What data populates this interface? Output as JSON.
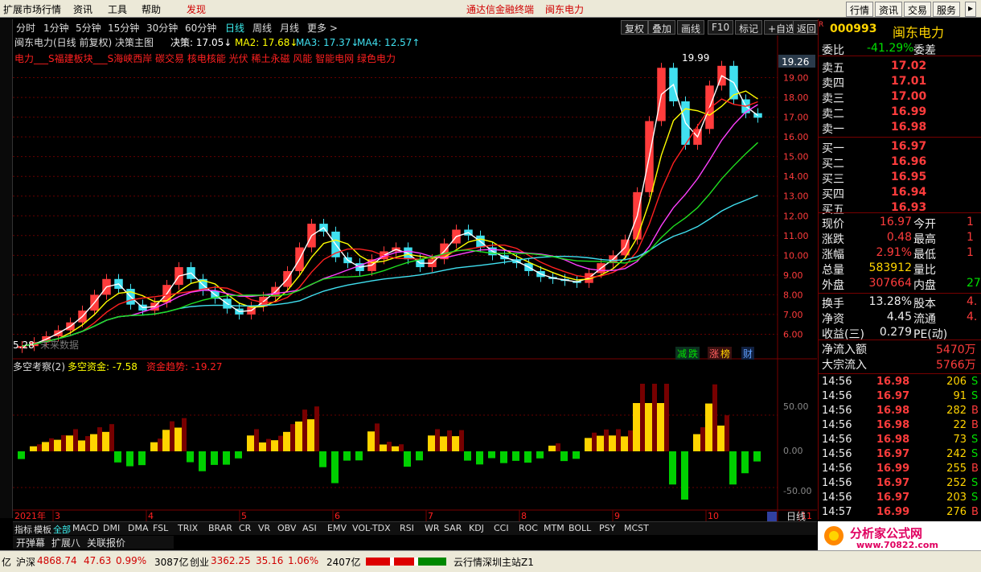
{
  "menu": {
    "items": [
      "扩展市场行情",
      "资讯",
      "工具",
      "帮助"
    ],
    "discover": "发现",
    "promo": "通达信金融终端",
    "promo_stock": "闽东电力",
    "sys_buttons": [
      "行情",
      "资讯",
      "交易",
      "服务"
    ]
  },
  "periods": [
    "分时",
    "1分钟",
    "5分钟",
    "15分钟",
    "30分钟",
    "60分钟",
    "日线",
    "周线",
    "月线",
    "更多 >"
  ],
  "active_period": "日线",
  "toolbar": [
    "复权",
    "叠加",
    "画线",
    "F10",
    "标记",
    "+自选",
    "返回"
  ],
  "chart_header": {
    "title": "闽东电力(日线 前复权) 决策主图",
    "decision": "决策: 17.05↓",
    "ma2": "MA2: 17.68↓",
    "ma3": "MA3: 17.37↓",
    "ma4": "MA4: 12.57↑",
    "concepts": "电力___S福建板块___S海峡西岸 碳交易 核电核能 光伏 稀土永磁 风能 智能电网 绿色电力",
    "high_label": "19.99",
    "low_label": "5.28",
    "future": "未来数据",
    "price_tag": "19.26",
    "badges": [
      "减",
      "跌",
      "涨",
      "榜",
      "财"
    ]
  },
  "price_axis": [
    "19.00",
    "18.00",
    "17.00",
    "16.00",
    "15.00",
    "14.00",
    "13.00",
    "12.00",
    "11.00",
    "10.00",
    "9.00",
    "8.00",
    "7.00",
    "6.00"
  ],
  "indicator": {
    "name": "多空考察(2)",
    "l1": "多空资金: -7.58",
    "l2": "资金趋势: -19.27",
    "axis": [
      "50.00",
      "0.00",
      "-50.00"
    ]
  },
  "time_axis": {
    "year": "2021年",
    "months": [
      "3",
      "4",
      "5",
      "6",
      "7",
      "8",
      "9",
      "10",
      "11"
    ],
    "period": "日线"
  },
  "indicator_tabs": [
    "指标",
    "模板",
    "全部",
    "MACD",
    "DMI",
    "DMA",
    "FSL",
    "TRIX",
    "BRAR",
    "CR",
    "VR",
    "OBV",
    "ASI",
    "EMV",
    "VOL-TDX",
    "RSI",
    "WR",
    "SAR",
    "KDJ",
    "CCI",
    "ROC",
    "MTM",
    "BOLL",
    "PSY",
    "MCST"
  ],
  "sub_tabs": [
    "开弹幕",
    "扩展八",
    "关联报价"
  ],
  "quote": {
    "code": "000993",
    "name": "闽东电力",
    "r": "R",
    "weibi_label": "委比",
    "weibi": "-41.29%",
    "weicha_label": "委差",
    "asks": [
      [
        "卖五",
        "17.02"
      ],
      [
        "卖四",
        "17.01"
      ],
      [
        "卖三",
        "17.00"
      ],
      [
        "卖二",
        "16.99"
      ],
      [
        "卖一",
        "16.98"
      ]
    ],
    "bids": [
      [
        "买一",
        "16.97"
      ],
      [
        "买二",
        "16.96"
      ],
      [
        "买三",
        "16.95"
      ],
      [
        "买四",
        "16.94"
      ],
      [
        "买五",
        "16.93"
      ]
    ],
    "stats": [
      [
        "现价",
        "16.97",
        "今开",
        "1"
      ],
      [
        "涨跌",
        "0.48",
        "最高",
        "1"
      ],
      [
        "涨幅",
        "2.91%",
        "最低",
        "1"
      ],
      [
        "总量",
        "583912",
        "量比",
        ""
      ],
      [
        "外盘",
        "307664",
        "内盘",
        "27"
      ],
      [
        "换手",
        "13.28%",
        "股本",
        "4."
      ],
      [
        "净资",
        "4.45",
        "流通",
        "4."
      ],
      [
        "收益(三)",
        "0.279",
        "PE(动)",
        ""
      ]
    ],
    "flow": [
      [
        "净流入额",
        "5470万"
      ],
      [
        "大宗流入",
        "5766万"
      ]
    ],
    "ticks": [
      [
        "14:56",
        "16.98",
        "206",
        "S"
      ],
      [
        "14:56",
        "16.97",
        "91",
        "S"
      ],
      [
        "14:56",
        "16.98",
        "282",
        "B"
      ],
      [
        "14:56",
        "16.98",
        "22",
        "B"
      ],
      [
        "14:56",
        "16.98",
        "73",
        "S"
      ],
      [
        "14:56",
        "16.97",
        "242",
        "S"
      ],
      [
        "14:56",
        "16.99",
        "255",
        "B"
      ],
      [
        "14:56",
        "16.97",
        "252",
        "S"
      ],
      [
        "14:56",
        "16.97",
        "203",
        "S"
      ],
      [
        "14:57",
        "16.99",
        "276",
        "B"
      ]
    ]
  },
  "logo": {
    "text": "分析家公式网",
    "url": "www.70822.com"
  },
  "status": {
    "a": "亿",
    "sh_label": "沪深",
    "sh": "4868.74",
    "sh_chg": "47.63",
    "sh_pct": "0.99%",
    "sh_vol": "3087亿",
    "cy_label": "创业",
    "cy": "3362.25",
    "cy_chg": "35.16",
    "cy_pct": "1.06%",
    "cy_vol": "2407亿",
    "server": "云行情深圳主站Z1"
  },
  "colors": {
    "up": "#ff3c3c",
    "down": "#00e000",
    "bg": "#000000",
    "ma_white": "#ffffff",
    "ma_yellow": "#ffff00",
    "ma_red": "#ff2020",
    "ma_magenta": "#ff40ff",
    "ma_cyan": "#40e0f0",
    "ma_green": "#20e020"
  },
  "chart_data": {
    "type": "candlestick",
    "price_range": [
      5.0,
      20.0
    ],
    "approx_closes": [
      5.4,
      5.6,
      5.9,
      6.2,
      6.6,
      7.2,
      8.0,
      8.8,
      8.3,
      7.5,
      7.2,
      7.6,
      8.5,
      9.4,
      8.8,
      8.2,
      7.8,
      7.3,
      7.0,
      7.4,
      7.9,
      8.4,
      9.2,
      10.4,
      11.6,
      11.2,
      9.9,
      9.6,
      9.2,
      9.8,
      10.2,
      10.4,
      9.8,
      9.4,
      9.8,
      10.6,
      11.3,
      11.0,
      10.4,
      10.0,
      9.8,
      9.6,
      9.2,
      8.9,
      8.8,
      8.7,
      8.6,
      9.1,
      9.6,
      10.0,
      10.8,
      13.2,
      16.8,
      19.5,
      17.8,
      15.6,
      16.4,
      18.6,
      19.6,
      17.9,
      17.2,
      16.97
    ]
  }
}
